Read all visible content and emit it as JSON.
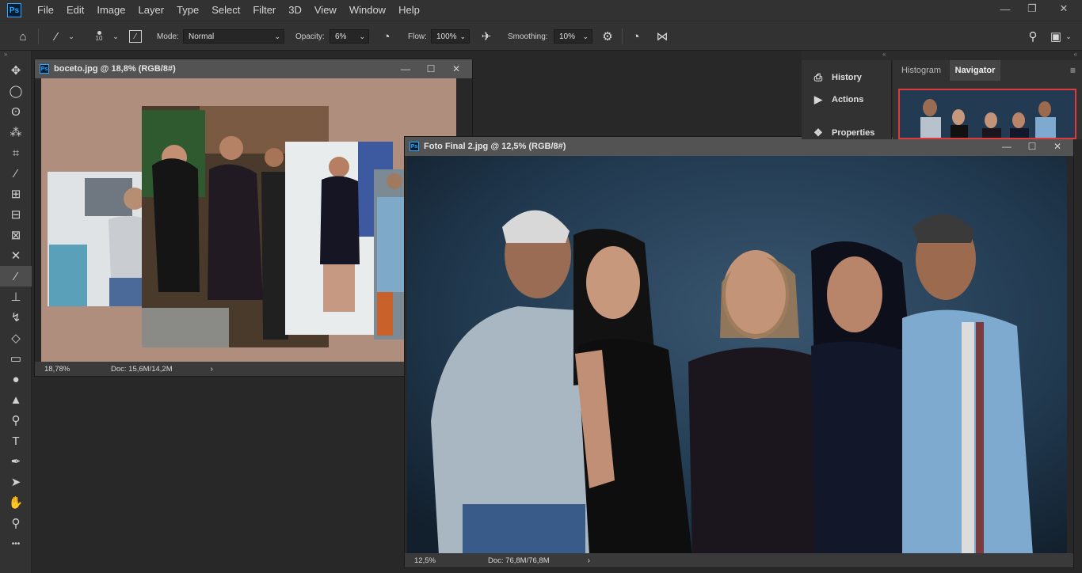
{
  "app": {
    "logo": "Ps",
    "menu": [
      "File",
      "Edit",
      "Image",
      "Layer",
      "Type",
      "Select",
      "Filter",
      "3D",
      "View",
      "Window",
      "Help"
    ],
    "window_controls": [
      "minimize-icon",
      "restore-icon",
      "close-icon"
    ]
  },
  "options": {
    "brush_size": "10",
    "mode_label": "Mode:",
    "mode_value": "Normal",
    "opacity_label": "Opacity:",
    "opacity_value": "6%",
    "flow_label": "Flow:",
    "flow_value": "100%",
    "smoothing_label": "Smoothing:",
    "smoothing_value": "10%"
  },
  "tools": [
    {
      "name": "move-tool",
      "glyph": "✥"
    },
    {
      "name": "elliptical-marquee-tool",
      "glyph": "◯"
    },
    {
      "name": "lasso-tool",
      "glyph": "ʘ"
    },
    {
      "name": "magic-wand-tool",
      "glyph": "⁂"
    },
    {
      "name": "crop-tool",
      "glyph": "⌗"
    },
    {
      "name": "eyedropper-tool",
      "glyph": "⁄"
    },
    {
      "name": "healing-brush-tool",
      "glyph": "⊞"
    },
    {
      "name": "patch-tool",
      "glyph": "⊟"
    },
    {
      "name": "frame-tool",
      "glyph": "⊠"
    },
    {
      "name": "content-aware-move-tool",
      "glyph": "✕"
    },
    {
      "name": "brush-tool",
      "glyph": "⁄",
      "active": true
    },
    {
      "name": "clone-stamp-tool",
      "glyph": "⊥"
    },
    {
      "name": "history-brush-tool",
      "glyph": "↯"
    },
    {
      "name": "eraser-tool",
      "glyph": "◇"
    },
    {
      "name": "gradient-tool",
      "glyph": "▭"
    },
    {
      "name": "blur-tool",
      "glyph": "●"
    },
    {
      "name": "sharpen-tool",
      "glyph": "▲"
    },
    {
      "name": "dodge-tool",
      "glyph": "⚲"
    },
    {
      "name": "type-tool",
      "glyph": "T"
    },
    {
      "name": "pen-tool",
      "glyph": "✒"
    },
    {
      "name": "path-selection-tool",
      "glyph": "➤"
    },
    {
      "name": "hand-tool",
      "glyph": "✋"
    },
    {
      "name": "zoom-tool",
      "glyph": "⚲"
    },
    {
      "name": "more-tools",
      "glyph": "•••"
    }
  ],
  "doc1": {
    "title": "boceto.jpg @ 18,8% (RGB/8#)",
    "zoom": "18,78%",
    "doc_size": "Doc: 15,6M/14,2M",
    "canvas_color": "#b08e7d"
  },
  "doc2": {
    "title": "Foto Final 2.jpg @ 12,5% (RGB/8#)",
    "zoom": "12,5%",
    "doc_size": "Doc: 76,8M/76,8M",
    "canvas_color": "#1f3446"
  },
  "panels": {
    "history": "History",
    "actions": "Actions",
    "properties": "Properties",
    "tab_histogram": "Histogram",
    "tab_navigator": "Navigator"
  }
}
